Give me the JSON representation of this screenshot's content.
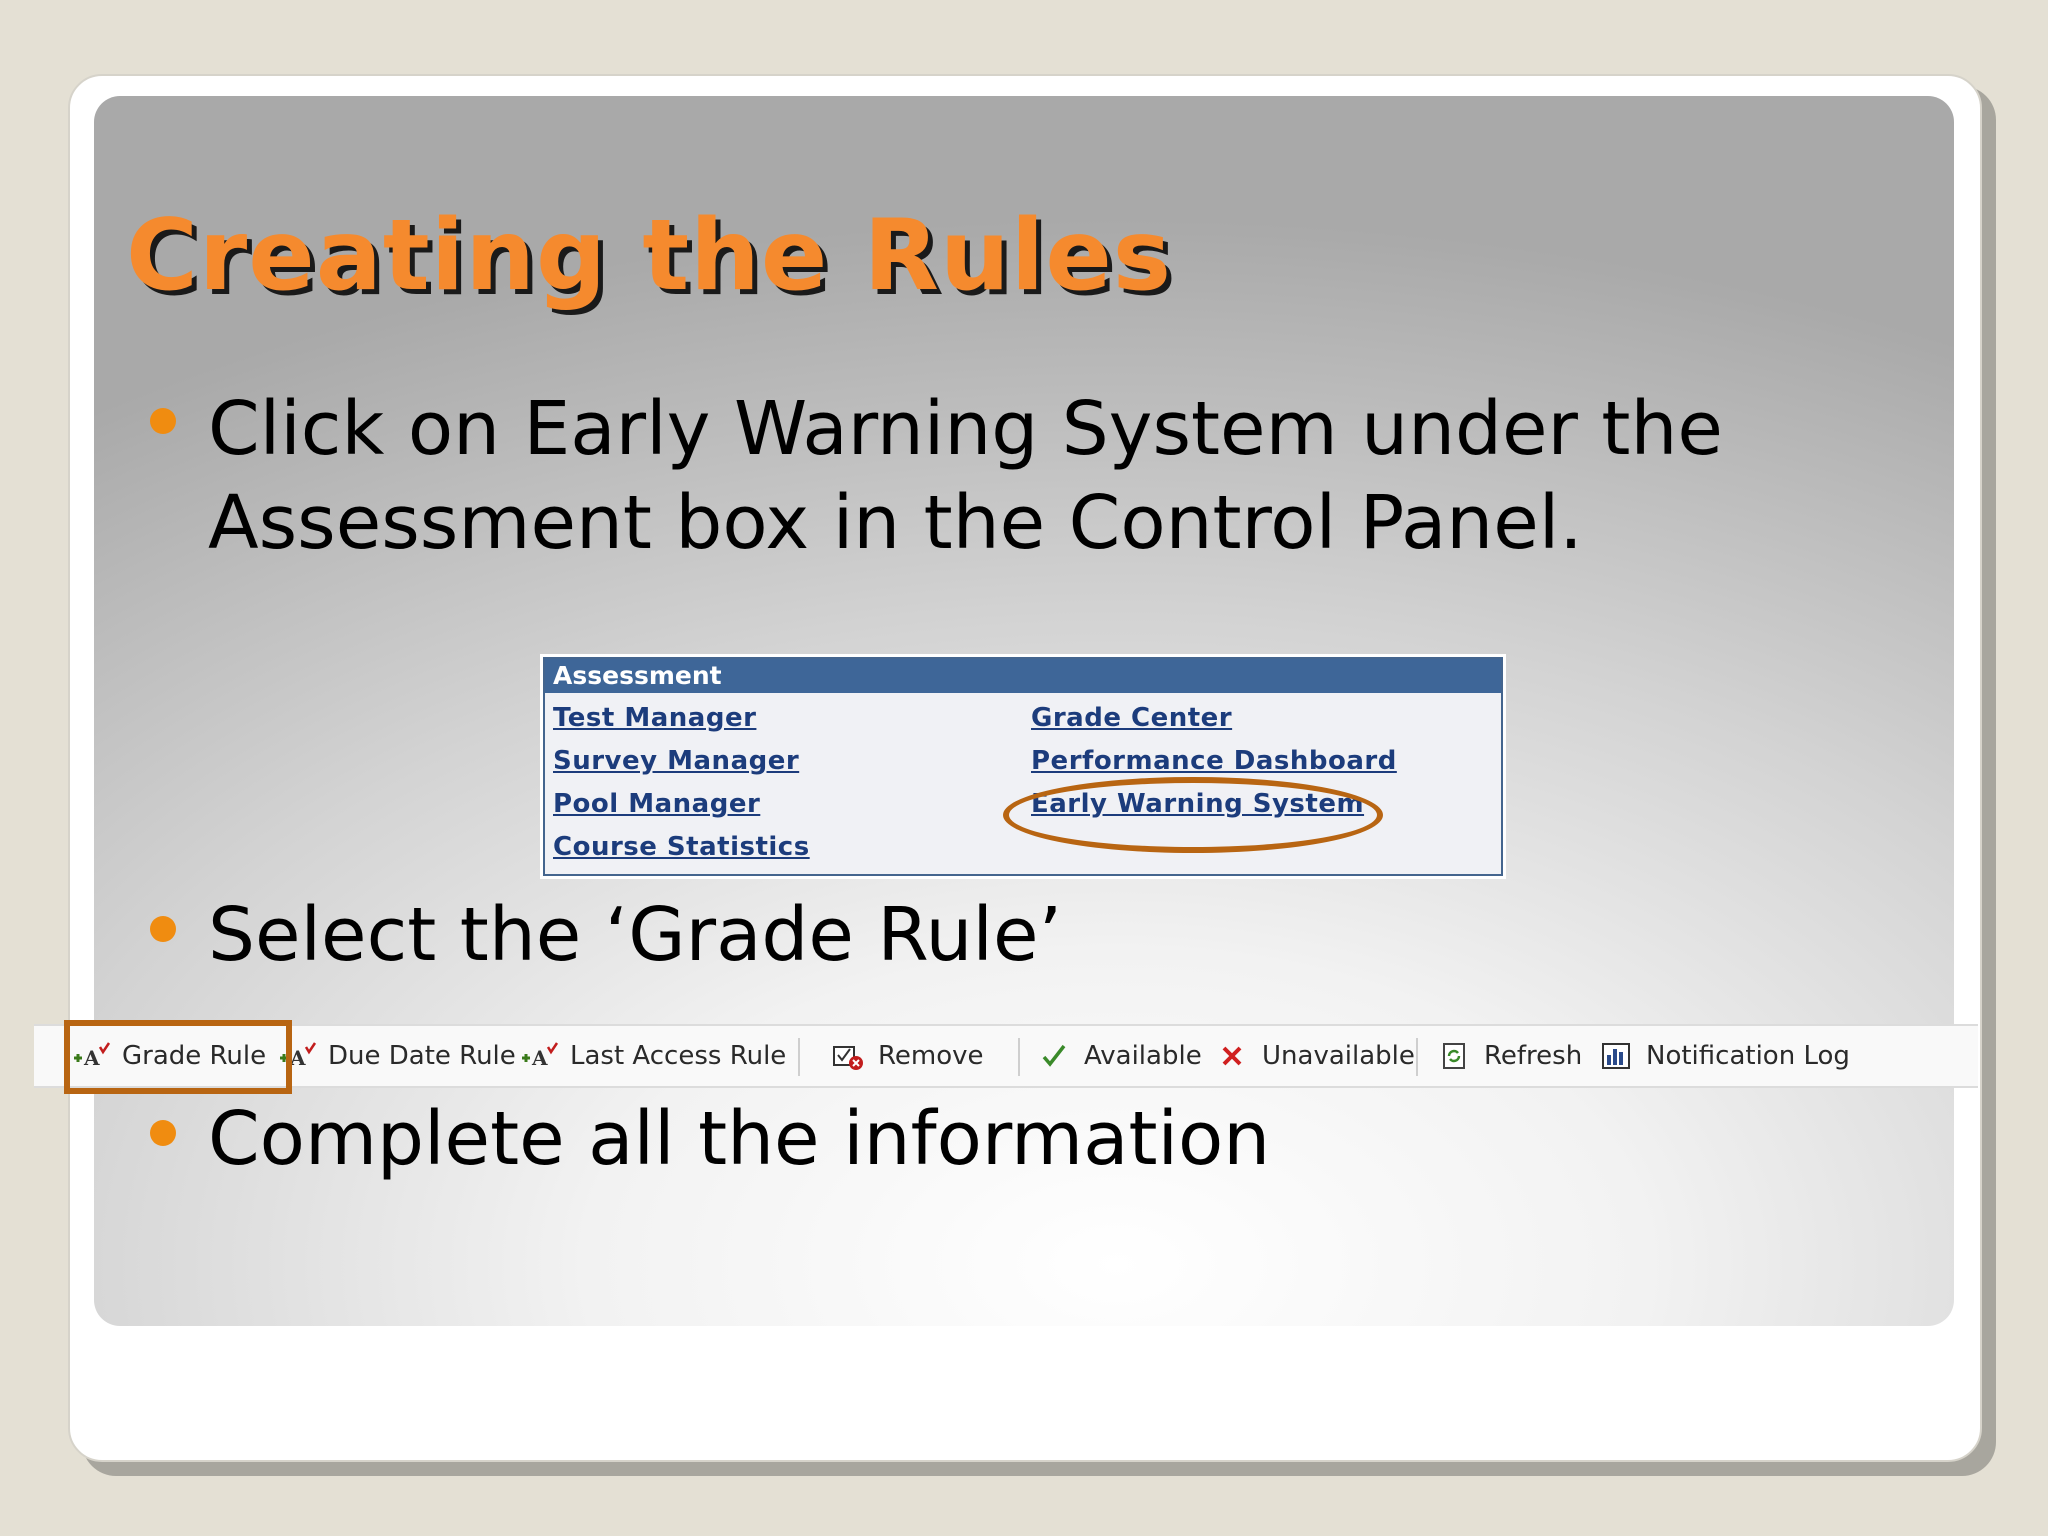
{
  "slide": {
    "title": "Creating the Rules",
    "bullets": [
      "Click on Early Warning System under the Assessment box in the Control Panel.",
      "Select the ‘Grade Rule’",
      "Complete all the information"
    ]
  },
  "assessment_panel": {
    "header": "Assessment",
    "left_links": [
      "Test Manager",
      "Survey Manager",
      "Pool Manager",
      "Course Statistics"
    ],
    "right_links": [
      "Grade Center",
      "Performance Dashboard",
      "Early Warning System"
    ]
  },
  "toolbar": {
    "items": [
      {
        "label": "Grade Rule",
        "icon": "grade-rule-icon"
      },
      {
        "label": "Due Date Rule",
        "icon": "due-date-rule-icon"
      },
      {
        "label": "Last Access Rule",
        "icon": "last-access-rule-icon"
      },
      {
        "label": "Remove",
        "icon": "remove-icon"
      },
      {
        "label": "Available",
        "icon": "checkmark-icon"
      },
      {
        "label": "Unavailable",
        "icon": "x-icon"
      },
      {
        "label": "Refresh",
        "icon": "refresh-icon"
      },
      {
        "label": "Notification Log",
        "icon": "bar-chart-icon"
      }
    ]
  },
  "colors": {
    "title": "#f58a2e",
    "bullet": "#f08c10",
    "assessment_header": "#3e6698",
    "link": "#1c3c7c",
    "highlight": "#b86512"
  }
}
